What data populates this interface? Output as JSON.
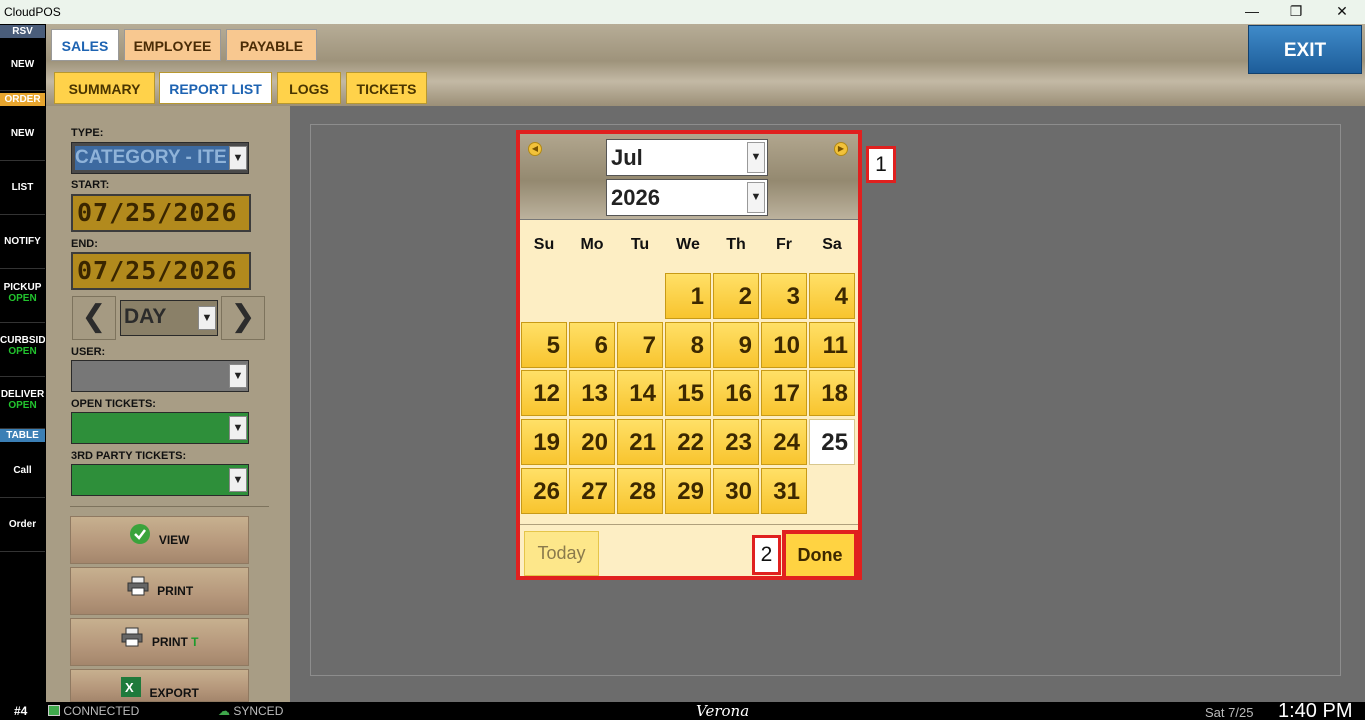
{
  "window": {
    "title": "CloudPOS",
    "minimize": "—",
    "restore": "❐",
    "close": "✕"
  },
  "sidebar": {
    "rsv": "RSV",
    "new1": "NEW",
    "order": "ORDER",
    "new2": "NEW",
    "list": "LIST",
    "notify": "NOTIFY",
    "pickup": "PICKUP",
    "pickup_status": "OPEN",
    "curbside": "CURBSID",
    "curbside_status": "OPEN",
    "delivery": "DELIVER",
    "delivery_status": "OPEN",
    "table": "TABLE",
    "call": "Call",
    "order2": "Order"
  },
  "tabs": {
    "sales": "SALES",
    "employee": "EMPLOYEE",
    "payable": "PAYABLE"
  },
  "subtabs": {
    "summary": "SUMMARY",
    "report_list": "REPORT LIST",
    "logs": "LOGS",
    "tickets": "TICKETS"
  },
  "exit_label": "EXIT",
  "filters": {
    "type_label": "TYPE:",
    "type_value": "CATEGORY - ITE",
    "start_label": "START:",
    "start_value": "07/25/2026",
    "end_label": "END:",
    "end_value": "07/25/2026",
    "period_value": "DAY",
    "user_label": "USER:",
    "open_tickets_label": "OPEN TICKETS:",
    "third_party_label": "3RD PARTY TICKETS:"
  },
  "actions": {
    "view": "VIEW",
    "print": "PRINT",
    "print_t": "PRINT",
    "print_t_suffix": "T",
    "export": "EXPORT"
  },
  "datepicker": {
    "month": "Jul",
    "year": "2026",
    "dow": [
      "Su",
      "Mo",
      "Tu",
      "We",
      "Th",
      "Fr",
      "Sa"
    ],
    "first_weekday": 3,
    "days_in_month": 31,
    "selected_day": 25,
    "today_label": "Today",
    "done_label": "Done"
  },
  "annotations": {
    "calendar": "1",
    "done": "2"
  },
  "statusbar": {
    "terminal": "#4",
    "connected": "CONNECTED",
    "synced": "SYNCED",
    "location": "Verona",
    "date": "Sat 7/25",
    "time": "1:40 PM"
  },
  "colors": {
    "accent_blue": "#1d63b2",
    "annotation_red": "#e0201f",
    "day_gold": "#f8c42e",
    "open_green": "#22c32e"
  }
}
